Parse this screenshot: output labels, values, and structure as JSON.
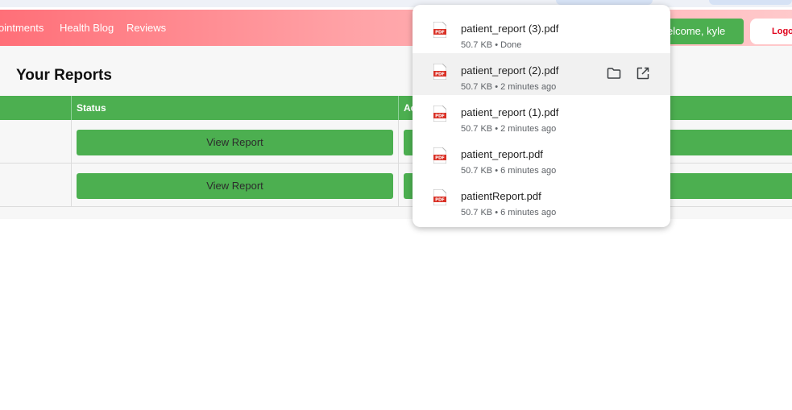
{
  "nav": {
    "links": [
      "ointments",
      "Health Blog",
      "Reviews"
    ],
    "welcome": "elcome, kyle",
    "logout": "Logo"
  },
  "page": {
    "title": "Your Reports",
    "columns": [
      "",
      "Status",
      "Ac"
    ],
    "rows": [
      {
        "status_button": "View Report"
      },
      {
        "status_button": "View Report"
      }
    ]
  },
  "downloads": {
    "items": [
      {
        "name": "patient_report (3).pdf",
        "meta": "50.7 KB • Done"
      },
      {
        "name": "patient_report (2).pdf",
        "meta": "50.7 KB • 2 minutes ago"
      },
      {
        "name": "patient_report (1).pdf",
        "meta": "50.7 KB • 2 minutes ago"
      },
      {
        "name": "patient_report.pdf",
        "meta": "50.7 KB • 6 minutes ago"
      },
      {
        "name": "patientReport.pdf",
        "meta": "50.7 KB • 6 minutes ago"
      }
    ],
    "icon_badge": "PDF",
    "hovered_index": 1,
    "actions": [
      "folder-icon",
      "open-external-icon"
    ]
  },
  "colors": {
    "accent_green": "#4caf50",
    "pdf_red": "#d93025",
    "logout_red": "#e0001a"
  }
}
